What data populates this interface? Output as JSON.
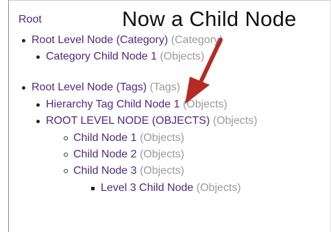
{
  "root_link": "Root",
  "overlay_title": "Now a Child Node",
  "tree": [
    {
      "label": "Root Level Node (Category)",
      "type": "(Category)"
    },
    {
      "label": "Category Child Node 1",
      "type": "(Objects)"
    },
    {
      "label": "Root Level Node (Tags)",
      "type": "(Tags)"
    },
    {
      "label": "Hierarchy Tag Child Node 1",
      "type": "(Objects)"
    },
    {
      "label": "ROOT LEVEL NODE (OBJECTS)",
      "type": "(Objects)"
    },
    {
      "label": "Child Node 1",
      "type": "(Objects)"
    },
    {
      "label": "Child Node 2",
      "type": "(Objects)"
    },
    {
      "label": "Child Node 3",
      "type": "(Objects)"
    },
    {
      "label": "Level 3 Child Node",
      "type": "(Objects)"
    }
  ],
  "colors": {
    "link": "#4b2a86",
    "type_text": "#9a9a9a",
    "arrow": "#b52a22"
  }
}
